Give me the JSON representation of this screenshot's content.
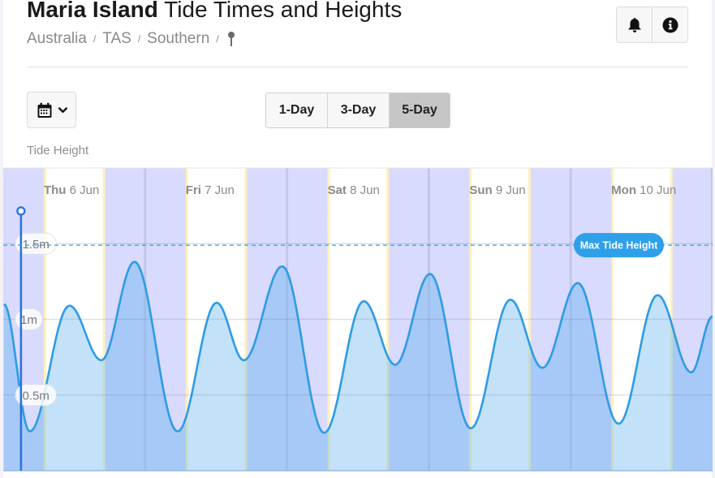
{
  "header": {
    "title_bold": "Maria Island",
    "title_rest": "Tide Times and Heights",
    "breadcrumb": [
      "Australia",
      "TAS",
      "Southern"
    ],
    "breadcrumb_separator": "/",
    "location_icon": "map-pin-icon",
    "buttons": [
      {
        "name": "alerts",
        "icon": "bell-icon"
      },
      {
        "name": "info",
        "icon": "info-icon"
      }
    ]
  },
  "controls": {
    "date_picker_icon": "calendar-icon",
    "date_picker_caret": "chevron-down-icon",
    "ranges": [
      {
        "label": "1-Day",
        "active": false
      },
      {
        "label": "3-Day",
        "active": false
      },
      {
        "label": "5-Day",
        "active": true
      }
    ]
  },
  "chart_title": "Tide Height",
  "colors": {
    "night_band": "#d8dbfd",
    "day_band": "#ffffff",
    "twilight": "#fff1bf",
    "midnight_line": "#c3c6e6",
    "tide_line": "#2e9be6",
    "tide_fill_day": "#c3e2fa",
    "tide_fill_night": "#a6c9f7",
    "now_marker": "#2b74df",
    "max_badge": "#2e9fe9"
  },
  "chart_data": {
    "type": "area",
    "title": "Tide Height",
    "xlabel": "",
    "ylabel": "Tide Height",
    "x_unit": "hours from Thu 6 Jun 00:00",
    "xlim": [
      0,
      120
    ],
    "ylim": [
      0,
      2
    ],
    "y_ticks": [
      {
        "value": 0.5,
        "label": "0.5m"
      },
      {
        "value": 1.0,
        "label": "1m"
      },
      {
        "value": 1.5,
        "label": "1.5m"
      }
    ],
    "days": [
      {
        "dow": "Thu",
        "date": "6 Jun",
        "sunrise_h": 7.0,
        "sunset_h": 17.1
      },
      {
        "dow": "Fri",
        "date": "7 Jun",
        "sunrise_h": 7.0,
        "sunset_h": 17.1
      },
      {
        "dow": "Sat",
        "date": "8 Jun",
        "sunrise_h": 7.0,
        "sunset_h": 17.1
      },
      {
        "dow": "Sun",
        "date": "9 Jun",
        "sunrise_h": 7.0,
        "sunset_h": 17.1
      },
      {
        "dow": "Mon",
        "date": "10 Jun",
        "sunrise_h": 7.0,
        "sunset_h": 17.1
      }
    ],
    "now_marker_h": 3.0,
    "max_tide": {
      "value": 1.49,
      "label": "Max Tide Height"
    },
    "series": [
      {
        "name": "Tide Height (m)",
        "points": [
          [
            0.1,
            1.1
          ],
          [
            4.5,
            0.26
          ],
          [
            11.2,
            1.09
          ],
          [
            16.6,
            0.73
          ],
          [
            22.2,
            1.38
          ],
          [
            29.5,
            0.26
          ],
          [
            36.1,
            1.11
          ],
          [
            40.7,
            0.73
          ],
          [
            47.2,
            1.35
          ],
          [
            54.3,
            0.25
          ],
          [
            61.0,
            1.12
          ],
          [
            66.3,
            0.7
          ],
          [
            72.2,
            1.3
          ],
          [
            79.1,
            0.28
          ],
          [
            85.8,
            1.13
          ],
          [
            91.2,
            0.68
          ],
          [
            97.2,
            1.24
          ],
          [
            104.1,
            0.31
          ],
          [
            110.7,
            1.16
          ],
          [
            116.4,
            0.65
          ],
          [
            120.0,
            1.02
          ]
        ]
      }
    ]
  }
}
